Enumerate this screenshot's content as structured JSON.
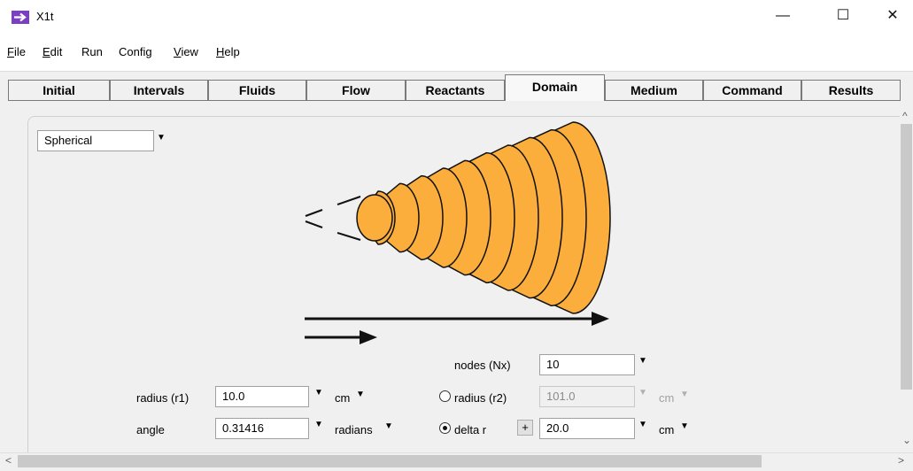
{
  "window": {
    "title": "X1t",
    "controls": {
      "minimize": "—",
      "maximize": "☐",
      "close": "✕"
    }
  },
  "menu": [
    {
      "label": "File",
      "mnemonic": "F",
      "rest": "ile"
    },
    {
      "label": "Edit",
      "mnemonic": "E",
      "rest": "dit"
    },
    {
      "label": "Run",
      "mnemonic": "",
      "rest": "Run"
    },
    {
      "label": "Config",
      "mnemonic": "",
      "rest": "Config"
    },
    {
      "label": "View",
      "mnemonic": "V",
      "rest": "iew"
    },
    {
      "label": "Help",
      "mnemonic": "H",
      "rest": "elp"
    }
  ],
  "tabs": [
    "Initial",
    "Intervals",
    "Fluids",
    "Flow",
    "Reactants",
    "Domain",
    "Medium",
    "Command",
    "Results"
  ],
  "active_tab": "Domain",
  "geometry_select": {
    "value": "Spherical"
  },
  "diagram": {
    "fill_color": "#fbae3c",
    "shells": 10
  },
  "form": {
    "nodes": {
      "label": "nodes (Nx)",
      "value": "10"
    },
    "radius_r1": {
      "label": "radius (r1)",
      "value": "10.0",
      "unit": "cm"
    },
    "radius_r2": {
      "label": "radius (r2)",
      "value": "101.0",
      "unit": "cm",
      "selected": false
    },
    "angle": {
      "label": "angle",
      "value": "0.31416",
      "unit": "radians"
    },
    "delta_r": {
      "label": "delta r",
      "value": "20.0",
      "unit": "cm",
      "selected": true,
      "plus": "+"
    }
  },
  "scroll": {
    "up": "^",
    "down": "⌄",
    "left": "<",
    "right": ">"
  }
}
